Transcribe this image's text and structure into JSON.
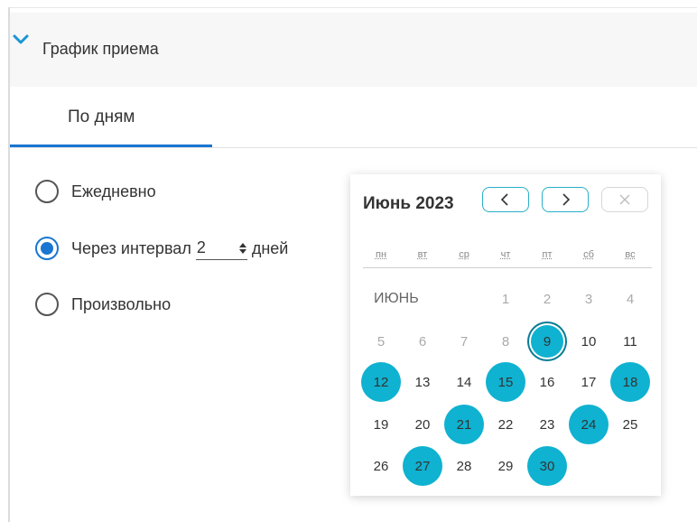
{
  "section": {
    "title": "График приема"
  },
  "tabs": [
    {
      "label": "По дням"
    }
  ],
  "schedule_options": {
    "daily": "Ежедневно",
    "interval_prefix": "Через интервал",
    "interval_value": "2",
    "interval_suffix": "дней",
    "custom": "Произвольно",
    "selected": "interval"
  },
  "calendar": {
    "title": "Июнь 2023",
    "month_label": "ИЮНЬ",
    "weekdays": [
      "пн",
      "вт",
      "ср",
      "чт",
      "пт",
      "сб",
      "вс"
    ],
    "days": [
      "1",
      "2",
      "3",
      "4",
      "5",
      "6",
      "7",
      "8",
      "9",
      "10",
      "11",
      "12",
      "13",
      "14",
      "15",
      "16",
      "17",
      "18",
      "19",
      "20",
      "21",
      "22",
      "23",
      "24",
      "25",
      "26",
      "27",
      "28",
      "29",
      "30"
    ],
    "selected_days": [
      12,
      15,
      18,
      21,
      24,
      27,
      30
    ],
    "today": 9,
    "muted_days": [
      1,
      2,
      3,
      4,
      5,
      6,
      7,
      8
    ],
    "accent_color": "#0fb2d0"
  },
  "icons": {
    "collapse": "chevron-down-icon",
    "prev": "chevron-left-icon",
    "next": "chevron-right-icon",
    "close": "close-icon",
    "spinner": "spinner-arrows-icon"
  }
}
